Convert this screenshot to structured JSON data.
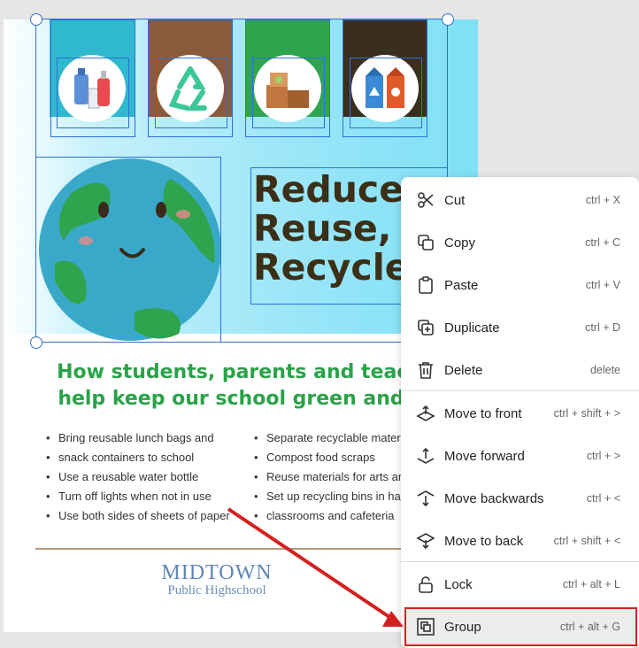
{
  "poster": {
    "title_lines": [
      "Reduce,",
      "Reuse,",
      "Recycle"
    ],
    "headline_lines": [
      "How students, parents and teachers",
      "help keep our school green and clea"
    ],
    "left_list": [
      "Bring reusable lunch bags and",
      "snack containers to school",
      "Use a reusable water bottle",
      "Turn off lights when not in use",
      "Use both sides of sheets of paper"
    ],
    "right_list": [
      "Separate recyclable materi",
      "Compost food scraps",
      "Reuse materials for arts an",
      "Set up recycling bins in hal",
      "classrooms and cafeteria"
    ],
    "brand_name": "MIDTOWN",
    "brand_sub": "Public Highschool",
    "bin_colors": [
      "#2fb9cf",
      "#8a5a3c",
      "#2ea44f",
      "#3a2f1f"
    ],
    "icons": [
      "bottles-icon",
      "recycle-icon",
      "boxes-icon",
      "cartons-icon",
      "earth-icon"
    ]
  },
  "context_menu": {
    "items": [
      {
        "label": "Cut",
        "shortcut": "ctrl + X",
        "icon": "scissors-icon"
      },
      {
        "label": "Copy",
        "shortcut": "ctrl + C",
        "icon": "copy-icon"
      },
      {
        "label": "Paste",
        "shortcut": "ctrl + V",
        "icon": "clipboard-icon"
      },
      {
        "label": "Duplicate",
        "shortcut": "ctrl + D",
        "icon": "duplicate-icon"
      },
      {
        "label": "Delete",
        "shortcut": "delete",
        "icon": "trash-icon"
      },
      {
        "label": "Move to front",
        "shortcut": "ctrl + shift + >",
        "icon": "move-to-front-icon"
      },
      {
        "label": "Move forward",
        "shortcut": "ctrl + >",
        "icon": "move-forward-icon"
      },
      {
        "label": "Move backwards",
        "shortcut": "ctrl + <",
        "icon": "move-backwards-icon"
      },
      {
        "label": "Move to back",
        "shortcut": "ctrl + shift + <",
        "icon": "move-to-back-icon"
      },
      {
        "label": "Lock",
        "shortcut": "ctrl + alt + L",
        "icon": "lock-icon"
      },
      {
        "label": "Group",
        "shortcut": "ctrl + alt + G",
        "icon": "group-icon"
      }
    ],
    "highlighted_item": "Group"
  },
  "colors": {
    "selection": "#2f6fd6",
    "annotation_red": "#d42020",
    "title_brown": "#3b2f17",
    "headline_green": "#2ba24a"
  }
}
